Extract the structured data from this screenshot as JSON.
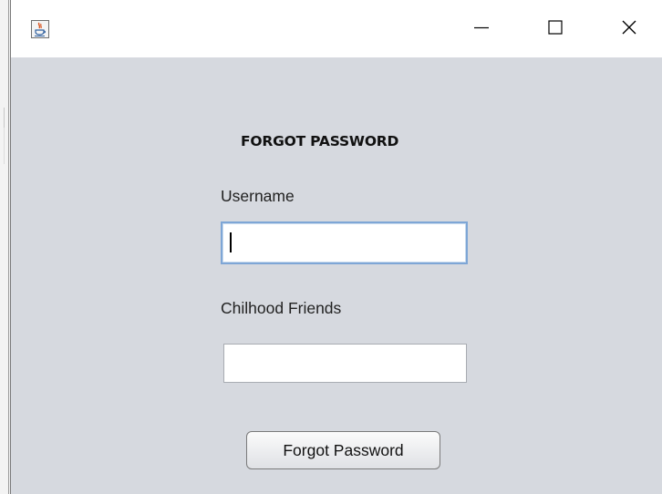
{
  "window": {
    "icon": "java-cup-icon",
    "controls": {
      "minimize": "minimize-icon",
      "maximize": "maximize-icon",
      "close": "close-icon"
    }
  },
  "form": {
    "title": "FORGOT PASSWORD",
    "username_label": "Username",
    "username_value": "",
    "friends_label": "Chilhood Friends",
    "friends_value": "",
    "submit_label": "Forgot Password"
  },
  "colors": {
    "panel_bg": "#d6d9df",
    "titlebar_bg": "#ffffff",
    "focus_border": "#7ea6d6"
  }
}
